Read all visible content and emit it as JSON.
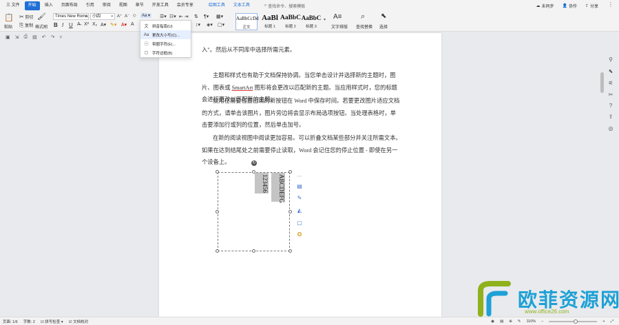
{
  "menu": {
    "file": "三 文件",
    "tabs": [
      "开始",
      "插入",
      "页面布局",
      "引用",
      "审阅",
      "视图",
      "章节",
      "开发工具",
      "会员专享"
    ],
    "context_tabs": [
      "绘图工具",
      "文本工具"
    ],
    "search": "查找命令、搜索模板",
    "right": [
      "未同步",
      "协作",
      "分享"
    ]
  },
  "ribbon": {
    "cut": "剪切",
    "copy": "复制",
    "paste": "粘贴",
    "format_painter": "格式刷",
    "font_name": "Times New Roma",
    "font_size": "小四",
    "case_button": "Aa",
    "styles": [
      {
        "sample": "AaBbCcDd",
        "label": "正文"
      },
      {
        "sample": "AaBl",
        "label": "标题 1"
      },
      {
        "sample": "AaBbC",
        "label": "标题 2"
      },
      {
        "sample": "AaBbC",
        "label": "标题 3"
      }
    ],
    "text_layout": "文字排版",
    "find_replace": "查找替换",
    "select": "选择"
  },
  "dropdown": {
    "items": [
      "拼音指南(U)",
      "更改大小写(C)...",
      "带圈字符(E)...",
      "字符边框(B)"
    ]
  },
  "document": {
    "paragraphs": [
      "入\"。然后从不同库中选择所需元素。",
      "主题和样式也有助于文档保持协调。当您单击设计并选择新的主题时，图片、图表或 SmartArt 图形将会更改以匹配新的主题。当应用样式时，您的标题会进行更改以匹配新的主题。",
      "使用在需要位置出现的新按钮在 Word 中保存时间。若要更改图片适应文档的方式，请单击该图片，图片旁边将会显示布局选项按钮。当处理表格时，单击要添加行或列的位置，然后单击加号。",
      "在新的阅读视图中阅读更加容易。可以折叠文档某些部分并关注所需文本。如果在达到结尾处之前需要停止读取，Word 会记住您的停止位置 - 即使在另一个设备上。"
    ],
    "textbox_col1": "ABCDEFG",
    "textbox_col2": "123456"
  },
  "status": {
    "page": "页面: 1/6",
    "words": "字数: 2",
    "spell": "拼写检查",
    "proof": "文档校对",
    "zoom": "110%",
    "zoom_fraction": 0.55
  },
  "watermark": {
    "name": "欧菲资源网",
    "url": "www.office26.com"
  },
  "colors": {
    "accent": "#1f6fd6",
    "watermark_blue": "#1da1d6",
    "watermark_green": "#8fb21c"
  }
}
